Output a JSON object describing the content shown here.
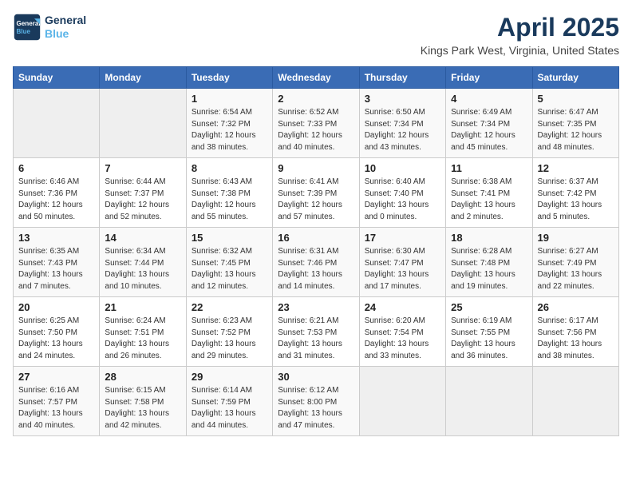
{
  "logo": {
    "line1": "General",
    "line2": "Blue"
  },
  "title": "April 2025",
  "location": "Kings Park West, Virginia, United States",
  "weekdays": [
    "Sunday",
    "Monday",
    "Tuesday",
    "Wednesday",
    "Thursday",
    "Friday",
    "Saturday"
  ],
  "weeks": [
    [
      {
        "num": "",
        "empty": true
      },
      {
        "num": "",
        "empty": true
      },
      {
        "num": "1",
        "sunrise": "6:54 AM",
        "sunset": "7:32 PM",
        "daylight": "12 hours and 38 minutes."
      },
      {
        "num": "2",
        "sunrise": "6:52 AM",
        "sunset": "7:33 PM",
        "daylight": "12 hours and 40 minutes."
      },
      {
        "num": "3",
        "sunrise": "6:50 AM",
        "sunset": "7:34 PM",
        "daylight": "12 hours and 43 minutes."
      },
      {
        "num": "4",
        "sunrise": "6:49 AM",
        "sunset": "7:34 PM",
        "daylight": "12 hours and 45 minutes."
      },
      {
        "num": "5",
        "sunrise": "6:47 AM",
        "sunset": "7:35 PM",
        "daylight": "12 hours and 48 minutes."
      }
    ],
    [
      {
        "num": "6",
        "sunrise": "6:46 AM",
        "sunset": "7:36 PM",
        "daylight": "12 hours and 50 minutes."
      },
      {
        "num": "7",
        "sunrise": "6:44 AM",
        "sunset": "7:37 PM",
        "daylight": "12 hours and 52 minutes."
      },
      {
        "num": "8",
        "sunrise": "6:43 AM",
        "sunset": "7:38 PM",
        "daylight": "12 hours and 55 minutes."
      },
      {
        "num": "9",
        "sunrise": "6:41 AM",
        "sunset": "7:39 PM",
        "daylight": "12 hours and 57 minutes."
      },
      {
        "num": "10",
        "sunrise": "6:40 AM",
        "sunset": "7:40 PM",
        "daylight": "13 hours and 0 minutes."
      },
      {
        "num": "11",
        "sunrise": "6:38 AM",
        "sunset": "7:41 PM",
        "daylight": "13 hours and 2 minutes."
      },
      {
        "num": "12",
        "sunrise": "6:37 AM",
        "sunset": "7:42 PM",
        "daylight": "13 hours and 5 minutes."
      }
    ],
    [
      {
        "num": "13",
        "sunrise": "6:35 AM",
        "sunset": "7:43 PM",
        "daylight": "13 hours and 7 minutes."
      },
      {
        "num": "14",
        "sunrise": "6:34 AM",
        "sunset": "7:44 PM",
        "daylight": "13 hours and 10 minutes."
      },
      {
        "num": "15",
        "sunrise": "6:32 AM",
        "sunset": "7:45 PM",
        "daylight": "13 hours and 12 minutes."
      },
      {
        "num": "16",
        "sunrise": "6:31 AM",
        "sunset": "7:46 PM",
        "daylight": "13 hours and 14 minutes."
      },
      {
        "num": "17",
        "sunrise": "6:30 AM",
        "sunset": "7:47 PM",
        "daylight": "13 hours and 17 minutes."
      },
      {
        "num": "18",
        "sunrise": "6:28 AM",
        "sunset": "7:48 PM",
        "daylight": "13 hours and 19 minutes."
      },
      {
        "num": "19",
        "sunrise": "6:27 AM",
        "sunset": "7:49 PM",
        "daylight": "13 hours and 22 minutes."
      }
    ],
    [
      {
        "num": "20",
        "sunrise": "6:25 AM",
        "sunset": "7:50 PM",
        "daylight": "13 hours and 24 minutes."
      },
      {
        "num": "21",
        "sunrise": "6:24 AM",
        "sunset": "7:51 PM",
        "daylight": "13 hours and 26 minutes."
      },
      {
        "num": "22",
        "sunrise": "6:23 AM",
        "sunset": "7:52 PM",
        "daylight": "13 hours and 29 minutes."
      },
      {
        "num": "23",
        "sunrise": "6:21 AM",
        "sunset": "7:53 PM",
        "daylight": "13 hours and 31 minutes."
      },
      {
        "num": "24",
        "sunrise": "6:20 AM",
        "sunset": "7:54 PM",
        "daylight": "13 hours and 33 minutes."
      },
      {
        "num": "25",
        "sunrise": "6:19 AM",
        "sunset": "7:55 PM",
        "daylight": "13 hours and 36 minutes."
      },
      {
        "num": "26",
        "sunrise": "6:17 AM",
        "sunset": "7:56 PM",
        "daylight": "13 hours and 38 minutes."
      }
    ],
    [
      {
        "num": "27",
        "sunrise": "6:16 AM",
        "sunset": "7:57 PM",
        "daylight": "13 hours and 40 minutes."
      },
      {
        "num": "28",
        "sunrise": "6:15 AM",
        "sunset": "7:58 PM",
        "daylight": "13 hours and 42 minutes."
      },
      {
        "num": "29",
        "sunrise": "6:14 AM",
        "sunset": "7:59 PM",
        "daylight": "13 hours and 44 minutes."
      },
      {
        "num": "30",
        "sunrise": "6:12 AM",
        "sunset": "8:00 PM",
        "daylight": "13 hours and 47 minutes."
      },
      {
        "num": "",
        "empty": true
      },
      {
        "num": "",
        "empty": true
      },
      {
        "num": "",
        "empty": true
      }
    ]
  ],
  "labels": {
    "sunrise": "Sunrise:",
    "sunset": "Sunset:",
    "daylight": "Daylight:"
  }
}
